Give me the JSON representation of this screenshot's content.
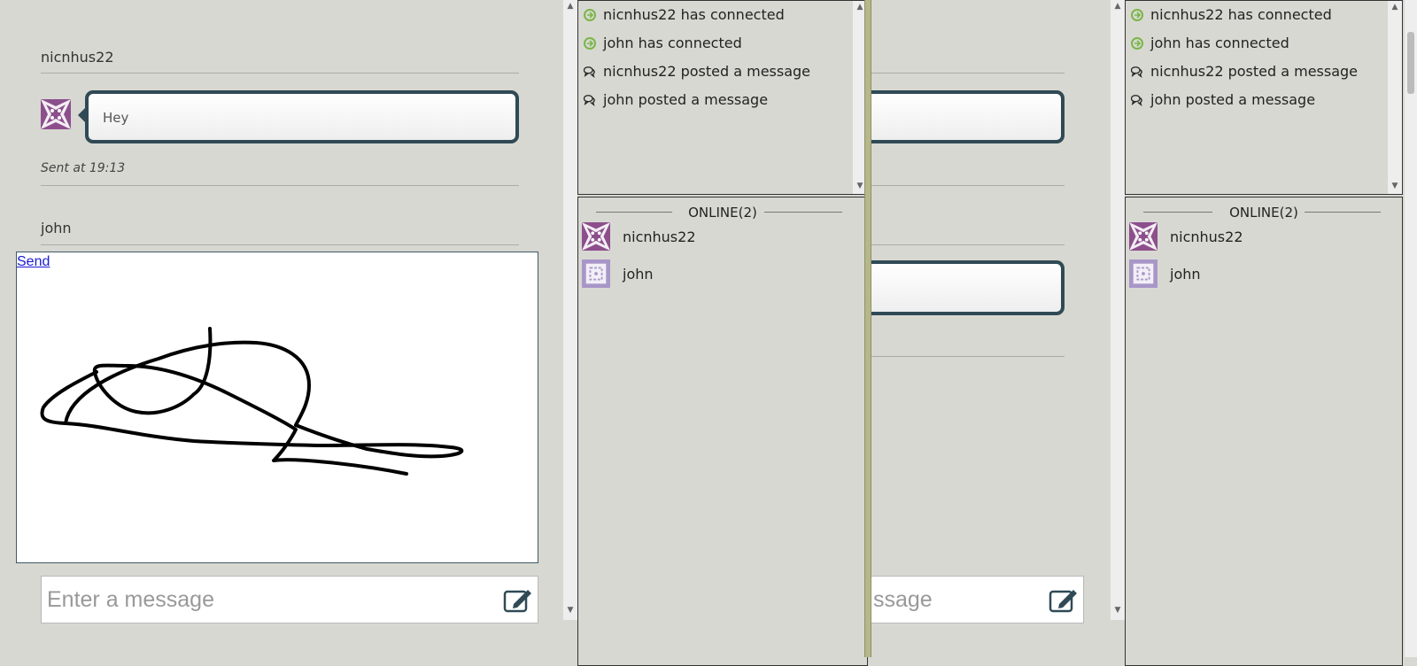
{
  "left": {
    "messages": [
      {
        "user": "nicnhus22",
        "text": "Hey",
        "sent": "Sent at 19:13"
      },
      {
        "user": "john"
      }
    ],
    "send_label": "Send",
    "input_placeholder": "Enter a message"
  },
  "middle": {
    "input_placeholder_partial": "ssage"
  },
  "activity": [
    {
      "icon": "connected-icon",
      "text": "nicnhus22 has connected"
    },
    {
      "icon": "connected-icon",
      "text": "john has connected"
    },
    {
      "icon": "message-icon",
      "text": "nicnhus22 posted a message"
    },
    {
      "icon": "message-icon",
      "text": "john posted a message"
    }
  ],
  "online": {
    "title": "ONLINE(2)",
    "users": [
      "nicnhus22",
      "john"
    ]
  },
  "colors": {
    "bubble_border": "#2f4a55",
    "connected_green": "#7ab648",
    "avatar_purple": "#8c4f8c",
    "avatar_lavender": "#a996c8"
  }
}
